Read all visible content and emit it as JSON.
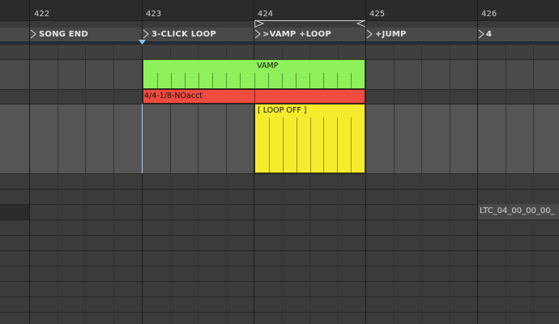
{
  "ruler": {
    "bars": [
      "422",
      "423",
      "424",
      "425",
      "426"
    ]
  },
  "locators": [
    {
      "label": "SONG END"
    },
    {
      "label": "3-CLICK LOOP"
    },
    {
      "label": ">VAMP +LOOP"
    },
    {
      "label": "+JUMP"
    },
    {
      "label": "4"
    }
  ],
  "clips": {
    "vamp": {
      "label": "VAMP",
      "color": "#8ef05a"
    },
    "time_signature": {
      "label": "4/4-1/8-NOacct",
      "color": "#ee4c3f"
    },
    "loop_off": {
      "label": "[ LOOP OFF ]",
      "color": "#f6eb2d"
    },
    "ltc": {
      "label": "LTC_04_00_00_00_"
    }
  },
  "colors": {
    "background": "#3a3a3a",
    "ruler": "#2b2b2b",
    "locator_lane": "#484848"
  }
}
